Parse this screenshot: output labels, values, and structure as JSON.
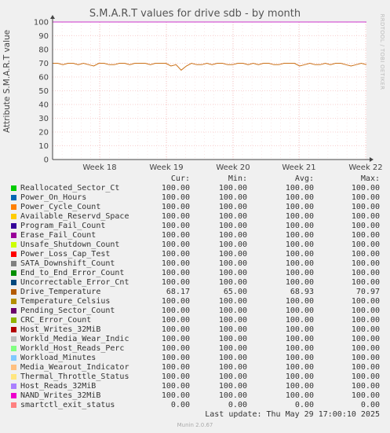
{
  "chart_data": {
    "type": "line",
    "title": "S.M.A.R.T values for drive sdb - by month",
    "ylabel": "Attribute S.M.A.R.T value",
    "ylim": [
      0,
      100
    ],
    "yticks": [
      0,
      10,
      20,
      30,
      40,
      50,
      60,
      70,
      80,
      90,
      100
    ],
    "x_ticks": [
      "Week 18",
      "Week 19",
      "Week 20",
      "Week 21",
      "Week 22"
    ],
    "grid": true,
    "series": [
      {
        "name": "Drive_Temperature",
        "color": "#cc7016",
        "values": [
          70,
          70,
          69,
          70,
          70,
          69,
          70,
          69,
          68,
          70,
          70,
          69,
          69,
          70,
          70,
          69,
          70,
          70,
          70,
          69,
          70,
          70,
          70,
          68,
          69,
          65,
          68,
          70,
          69,
          69,
          70,
          69,
          70,
          70,
          69,
          69,
          70,
          70,
          69,
          70,
          69,
          70,
          70,
          69,
          69,
          70,
          70,
          70,
          68,
          69,
          70,
          69,
          69,
          70,
          69,
          70,
          70,
          69,
          68,
          69,
          70,
          69
        ]
      },
      {
        "name": "Power_On_Hours",
        "color": "#cc33cc",
        "values": [
          100,
          100
        ]
      },
      {
        "name": "smartctl_exit_status",
        "color": "#ff6666",
        "values": [
          0,
          0
        ]
      }
    ]
  },
  "title": "S.M.A.R.T values for drive sdb - by month",
  "ylabel": "Attribute S.M.A.R.T value",
  "sidetag": "RRDTOOL / TOBI OETIKER",
  "legend_headers": {
    "cur": "Cur:",
    "min": "Min:",
    "avg": "Avg:",
    "max": "Max:"
  },
  "legend": [
    {
      "name": "Reallocated_Sector_Ct",
      "color": "#00cc00",
      "cur": "100.00",
      "min": "100.00",
      "avg": "100.00",
      "max": "100.00"
    },
    {
      "name": "Power_On_Hours",
      "color": "#0066b3",
      "cur": "100.00",
      "min": "100.00",
      "avg": "100.00",
      "max": "100.00"
    },
    {
      "name": "Power_Cycle_Count",
      "color": "#ff8000",
      "cur": "100.00",
      "min": "100.00",
      "avg": "100.00",
      "max": "100.00"
    },
    {
      "name": "Available_Reservd_Space",
      "color": "#ffcc00",
      "cur": "100.00",
      "min": "100.00",
      "avg": "100.00",
      "max": "100.00"
    },
    {
      "name": "Program_Fail_Count",
      "color": "#330099",
      "cur": "100.00",
      "min": "100.00",
      "avg": "100.00",
      "max": "100.00"
    },
    {
      "name": "Erase_Fail_Count",
      "color": "#990099",
      "cur": "100.00",
      "min": "100.00",
      "avg": "100.00",
      "max": "100.00"
    },
    {
      "name": "Unsafe_Shutdown_Count",
      "color": "#ccff00",
      "cur": "100.00",
      "min": "100.00",
      "avg": "100.00",
      "max": "100.00"
    },
    {
      "name": "Power_Loss_Cap_Test",
      "color": "#ff0000",
      "cur": "100.00",
      "min": "100.00",
      "avg": "100.00",
      "max": "100.00"
    },
    {
      "name": "SATA_Downshift_Count",
      "color": "#808080",
      "cur": "100.00",
      "min": "100.00",
      "avg": "100.00",
      "max": "100.00"
    },
    {
      "name": "End_to_End_Error_Count",
      "color": "#008f00",
      "cur": "100.00",
      "min": "100.00",
      "avg": "100.00",
      "max": "100.00"
    },
    {
      "name": "Uncorrectable_Error_Cnt",
      "color": "#00487d",
      "cur": "100.00",
      "min": "100.00",
      "avg": "100.00",
      "max": "100.00"
    },
    {
      "name": "Drive_Temperature",
      "color": "#b35a00",
      "cur": "68.17",
      "min": "65.00",
      "avg": "68.93",
      "max": "70.97"
    },
    {
      "name": "Temperature_Celsius",
      "color": "#b38f00",
      "cur": "100.00",
      "min": "100.00",
      "avg": "100.00",
      "max": "100.00"
    },
    {
      "name": "Pending_Sector_Count",
      "color": "#6b006b",
      "cur": "100.00",
      "min": "100.00",
      "avg": "100.00",
      "max": "100.00"
    },
    {
      "name": "CRC_Error_Count",
      "color": "#8fb300",
      "cur": "100.00",
      "min": "100.00",
      "avg": "100.00",
      "max": "100.00"
    },
    {
      "name": "Host_Writes_32MiB",
      "color": "#b30000",
      "cur": "100.00",
      "min": "100.00",
      "avg": "100.00",
      "max": "100.00"
    },
    {
      "name": "Workld_Media_Wear_Indic",
      "color": "#bebebe",
      "cur": "100.00",
      "min": "100.00",
      "avg": "100.00",
      "max": "100.00"
    },
    {
      "name": "Workld_Host_Reads_Perc",
      "color": "#80ff80",
      "cur": "100.00",
      "min": "100.00",
      "avg": "100.00",
      "max": "100.00"
    },
    {
      "name": "Workload_Minutes",
      "color": "#80c9ff",
      "cur": "100.00",
      "min": "100.00",
      "avg": "100.00",
      "max": "100.00"
    },
    {
      "name": "Media_Wearout_Indicator",
      "color": "#ffc080",
      "cur": "100.00",
      "min": "100.00",
      "avg": "100.00",
      "max": "100.00"
    },
    {
      "name": "Thermal_Throttle_Status",
      "color": "#ffe680",
      "cur": "100.00",
      "min": "100.00",
      "avg": "100.00",
      "max": "100.00"
    },
    {
      "name": "Host_Reads_32MiB",
      "color": "#aa80ff",
      "cur": "100.00",
      "min": "100.00",
      "avg": "100.00",
      "max": "100.00"
    },
    {
      "name": "NAND_Writes_32MiB",
      "color": "#ee00cc",
      "cur": "100.00",
      "min": "100.00",
      "avg": "100.00",
      "max": "100.00"
    },
    {
      "name": "smartctl_exit_status",
      "color": "#ff8080",
      "cur": "0.00",
      "min": "0.00",
      "avg": "0.00",
      "max": "0.00"
    }
  ],
  "last_update": "Last update: Thu May 29 17:00:10 2025",
  "footer": "Munin 2.0.67"
}
